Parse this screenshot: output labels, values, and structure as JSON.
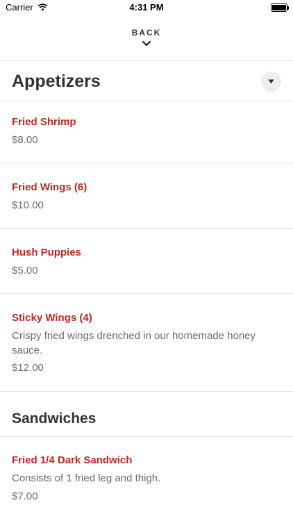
{
  "status_bar": {
    "carrier": "Carrier",
    "time": "4:31 PM"
  },
  "nav": {
    "back_label": "BACK"
  },
  "categories": [
    {
      "title": "Appetizers",
      "items": [
        {
          "name": "Fried Shrimp",
          "price": "$8.00"
        },
        {
          "name": "Fried Wings (6)",
          "price": "$10.00"
        },
        {
          "name": "Hush Puppies",
          "price": "$5.00"
        },
        {
          "name": "Sticky Wings (4)",
          "description": "Crispy fried wings drenched in our homemade honey sauce.",
          "price": "$12.00"
        }
      ]
    },
    {
      "title": "Sandwiches",
      "items": [
        {
          "name": "Fried 1/4 Dark Sandwich",
          "description": "Consists of 1 fried leg and thigh.",
          "price": "$7.00"
        }
      ]
    }
  ],
  "colors": {
    "accent": "#c0261e",
    "text": "#333333",
    "muted": "#6b6b6b",
    "divider": "#e6e6e6"
  },
  "icons": {
    "back": "chevron-down-icon",
    "category_toggle": "caret-down-icon",
    "signal": "wifi-icon"
  }
}
